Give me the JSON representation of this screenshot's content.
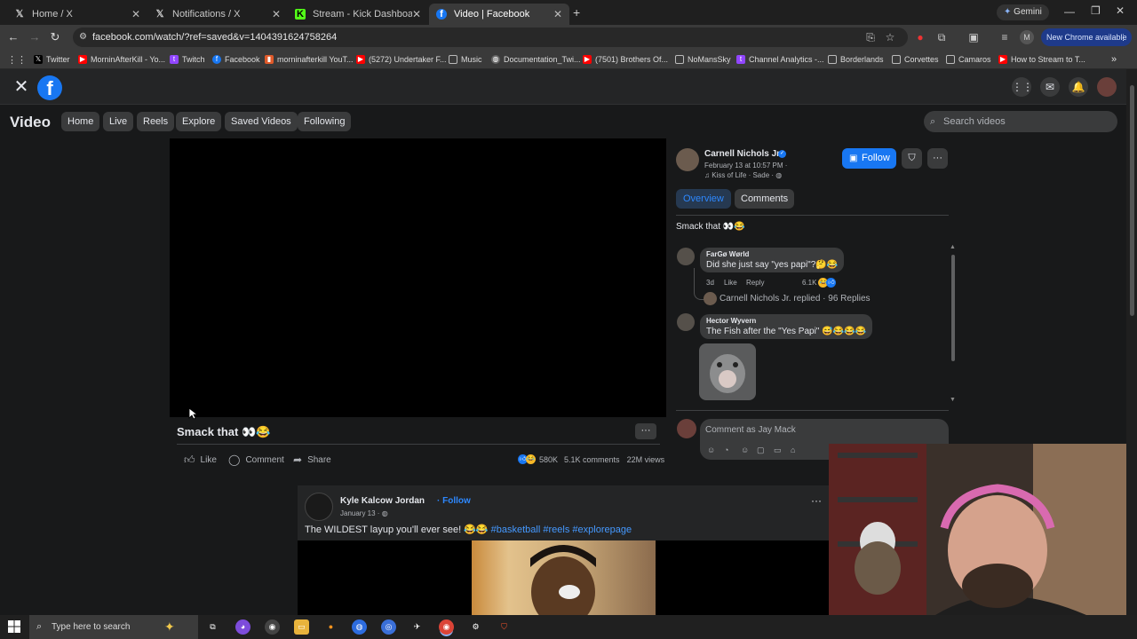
{
  "browser": {
    "tabs": [
      {
        "label": "Home / X",
        "icon": "x-logo-icon"
      },
      {
        "label": "Notifications / X",
        "icon": "x-logo-icon"
      },
      {
        "label": "Stream - Kick Dashboard",
        "icon": "kick-logo-icon"
      },
      {
        "label": "Video | Facebook",
        "icon": "facebook-logo-icon"
      }
    ],
    "gemini_label": "Gemini",
    "url": "facebook.com/watch/?ref=saved&v=1404391624758264",
    "update_label": "New Chrome available",
    "bookmarks": [
      {
        "label": "Twitter",
        "color": "#000000"
      },
      {
        "label": "MorninAfterKill - Yo...",
        "color": "#ff0000"
      },
      {
        "label": "Twitch",
        "color": "#9146ff"
      },
      {
        "label": "Facebook",
        "color": "#1877f2"
      },
      {
        "label": "morninafterkill YouT...",
        "color": "#e05a2a"
      },
      {
        "label": "(5272) Undertaker F...",
        "color": "#ff0000"
      },
      {
        "label": "Music",
        "color": "#888888"
      },
      {
        "label": "Documentation_Twi...",
        "color": "#888888"
      },
      {
        "label": "(7501) Brothers Of...",
        "color": "#ff0000"
      },
      {
        "label": "NoMansSky",
        "color": "#888888"
      },
      {
        "label": "Channel Analytics -...",
        "color": "#9146ff"
      },
      {
        "label": "Borderlands",
        "color": "#888888"
      },
      {
        "label": "Corvettes",
        "color": "#888888"
      },
      {
        "label": "Camaros",
        "color": "#888888"
      },
      {
        "label": "How to Stream to T...",
        "color": "#ff0000"
      }
    ]
  },
  "fb": {
    "logo_letter": "f",
    "section_title": "Video",
    "nav": [
      "Home",
      "Live",
      "Reels",
      "Explore",
      "Saved Videos",
      "Following"
    ],
    "search_placeholder": "Search videos"
  },
  "post": {
    "caption": "Smack that 👀😂",
    "like_label": "Like",
    "comment_label": "Comment",
    "share_label": "Share",
    "reactions_count": "580K",
    "comments_count": "5.1K comments",
    "views": "22M views",
    "author": "Carnell Nichols Jr.",
    "date": "February 13 at 10:57 PM ·",
    "song": "♫ Kiss of Life · Sade · ",
    "follow_label": "Follow",
    "tab_overview": "Overview",
    "tab_comments": "Comments",
    "description": "Smack that 👀😂"
  },
  "comments": [
    {
      "name": "FarGø Wørld",
      "text": "Did she just say \"yes papi\"?🤔😂",
      "age": "3d",
      "like": "Like",
      "reply": "Reply",
      "reactions": "6.1K"
    },
    {
      "reply_summary": "Carnell Nichols Jr. replied · 96 Replies"
    },
    {
      "name": "Hector Wyvern",
      "text": "The Fish after the \"Yes Papi\" 😅😂😂😂"
    }
  ],
  "comment_box": {
    "placeholder": "Comment as Jay Mack"
  },
  "post2": {
    "author": "Kyle Kalcow Jordan",
    "follow": "· Follow",
    "date": "January 13 · ",
    "text_plain": "The WILDEST layup you'll ever see! 😂😂 ",
    "tags": [
      "#basketball",
      "#reels",
      "#explorepage"
    ]
  },
  "taskbar": {
    "search_placeholder": "Type here to search"
  }
}
